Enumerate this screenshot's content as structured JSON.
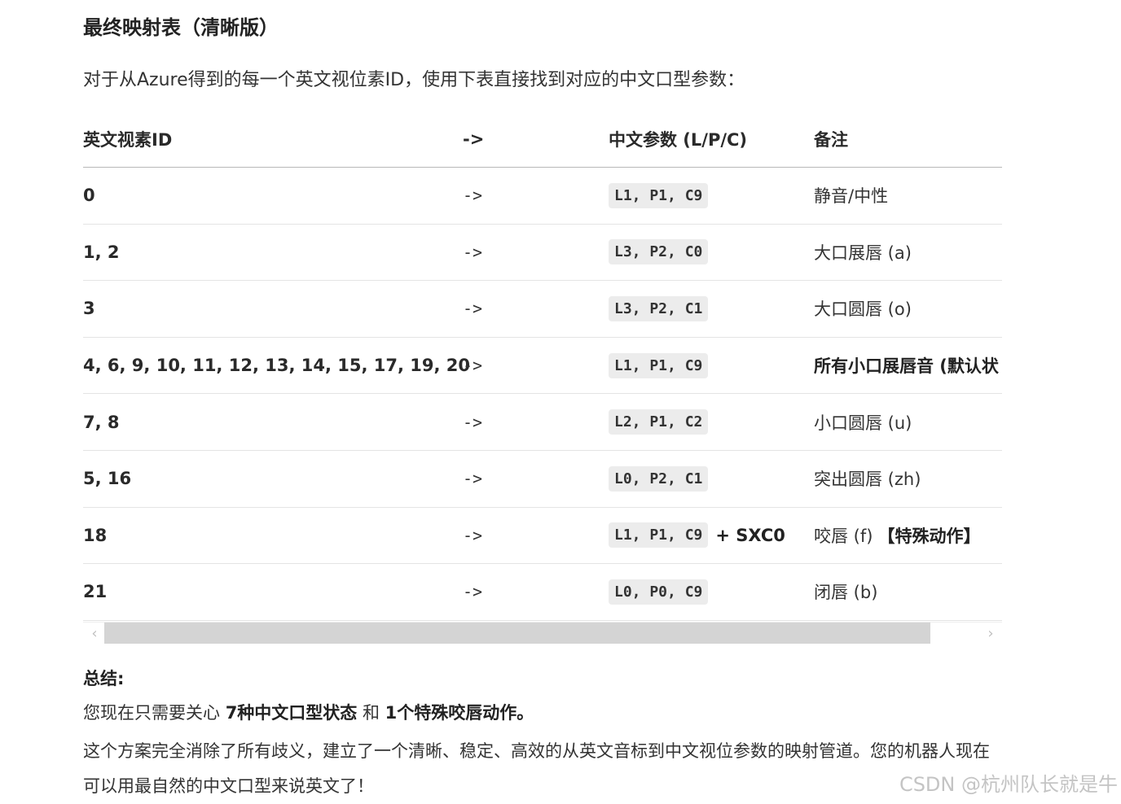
{
  "section_title": "最终映射表（清晰版）",
  "intro": "对于从Azure得到的每一个英文视位素ID，使用下表直接找到对应的中文口型参数：",
  "table": {
    "headers": {
      "id": "英文视素ID",
      "arrow": "->",
      "param": "中文参数 (L/P/C)",
      "note": "备注"
    },
    "rows": [
      {
        "id": "0",
        "arrow": "->",
        "param": "L1, P1, C9",
        "extra": "",
        "note": "静音/中性",
        "note_strong": ""
      },
      {
        "id": "1, 2",
        "arrow": "->",
        "param": "L3, P2, C0",
        "extra": "",
        "note": "大口展唇 (a)",
        "note_strong": ""
      },
      {
        "id": "3",
        "arrow": "->",
        "param": "L3, P2, C1",
        "extra": "",
        "note": "大口圆唇 (o)",
        "note_strong": ""
      },
      {
        "id": "4, 6, 9, 10, 11, 12, 13, 14, 15, 17, 19, 20",
        "arrow": "->",
        "param": "L1, P1, C9",
        "extra": "",
        "note": "所有小口展唇音 (默认状",
        "note_strong": "",
        "note_bold": true
      },
      {
        "id": "7, 8",
        "arrow": "->",
        "param": "L2, P1, C2",
        "extra": "",
        "note": "小口圆唇 (u)",
        "note_strong": ""
      },
      {
        "id": "5, 16",
        "arrow": "->",
        "param": "L0, P2, C1",
        "extra": "",
        "note": "突出圆唇 (zh)",
        "note_strong": ""
      },
      {
        "id": "18",
        "arrow": "->",
        "param": "L1, P1, C9",
        "extra": "+ SXC0",
        "note": "咬唇 (f)",
        "note_strong": "【特殊动作】"
      },
      {
        "id": "21",
        "arrow": "->",
        "param": "L0, P0, C9",
        "extra": "",
        "note": "闭唇 (b)",
        "note_strong": ""
      }
    ]
  },
  "scrollbar": {
    "left_arrow": "‹",
    "right_arrow": "›",
    "scroll_position": 0
  },
  "summary": {
    "title": "总结:",
    "line1_prefix": "您现在只需要关心 ",
    "line1_bold1": "7种中文口型状态",
    "line1_mid": " 和 ",
    "line1_bold2": "1个特殊咬唇动作。",
    "paragraph": "这个方案完全消除了所有歧义，建立了一个清晰、稳定、高效的从英文音标到中文视位参数的映射管道。您的机器人现在可以用最自然的中文口型来说英文了！"
  },
  "watermark": "CSDN @杭州队长就是牛"
}
